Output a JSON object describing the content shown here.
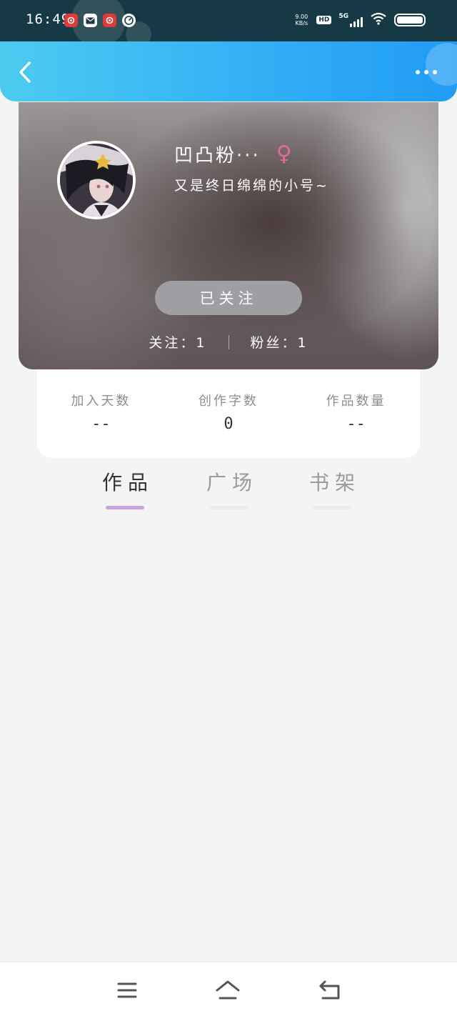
{
  "status_bar": {
    "time": "16:49",
    "net_speed_value": "9.00",
    "net_speed_unit": "KB/s",
    "hd_label": "HD",
    "network_label": "5G"
  },
  "header": {
    "back_icon": "chevron-left-icon",
    "more_icon": "more-horizontal-icon"
  },
  "profile": {
    "nickname": "凹凸粉···",
    "gender_icon": "female-icon",
    "gender_symbol": "♀",
    "gender_color": "#e46a9a",
    "bio": "又是终日绵绵的小号~",
    "follow_button_label": "已关注",
    "following_label": "关注：1",
    "followers_label": "粉丝：1"
  },
  "stats": [
    {
      "label": "加入天数",
      "value": "--"
    },
    {
      "label": "创作字数",
      "value": "0"
    },
    {
      "label": "作品数量",
      "value": "--"
    }
  ],
  "tabs": [
    {
      "label": "作品",
      "active": true
    },
    {
      "label": "广场",
      "active": false
    },
    {
      "label": "书架",
      "active": false
    }
  ],
  "colors": {
    "header_start": "#4ccbef",
    "header_end": "#1f9cf5",
    "active_tab_underline": "#c8a5df",
    "follow_button": "#a09ea3"
  },
  "bottom_nav": {
    "items": [
      "menu-icon",
      "home-icon",
      "back-icon"
    ]
  }
}
